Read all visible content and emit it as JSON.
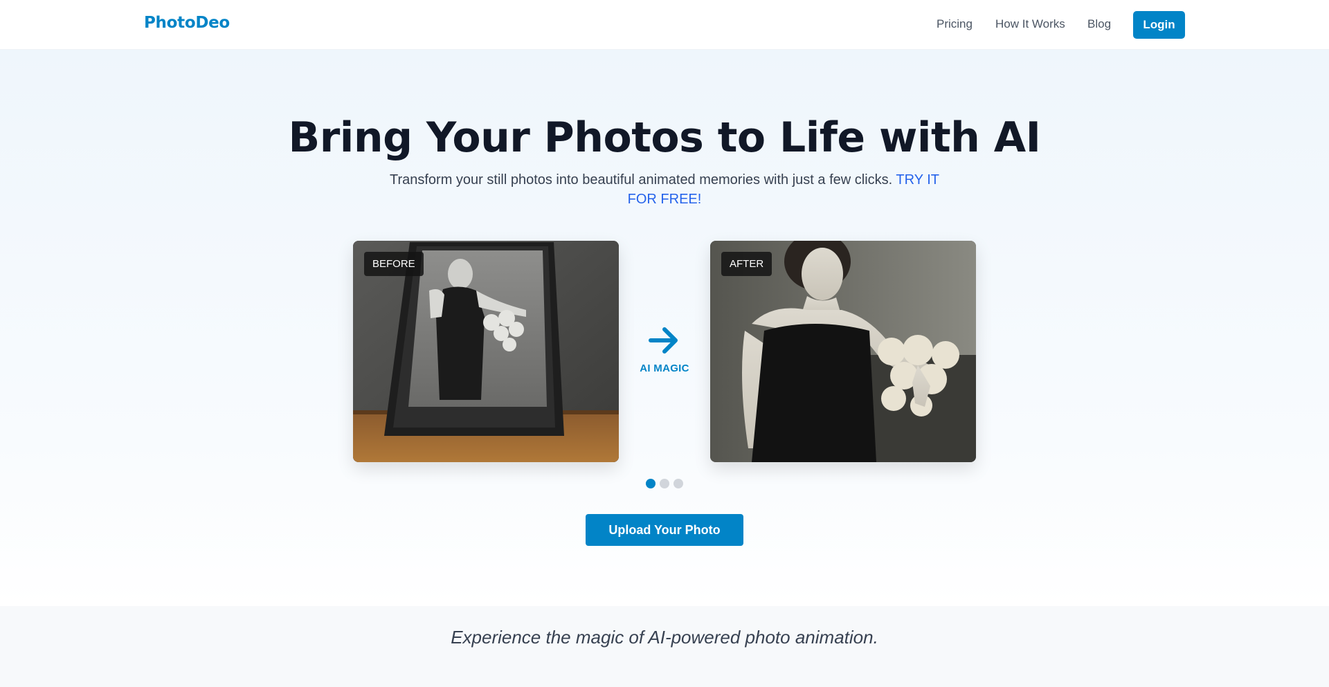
{
  "header": {
    "logo": "PhotoDeo",
    "nav": {
      "pricing": "Pricing",
      "how_it_works": "How It Works",
      "blog": "Blog"
    },
    "login_label": "Login"
  },
  "hero": {
    "title": "Bring Your Photos to Life with AI",
    "subtitle": "Transform your still photos into beautiful animated memories with just a few clicks.",
    "cta_text": "TRY IT FOR FREE!",
    "before_label": "BEFORE",
    "after_label": "AFTER",
    "magic_label": "AI MAGIC",
    "carousel": {
      "active_index": 0,
      "total": 3
    },
    "upload_label": "Upload Your Photo"
  },
  "band": {
    "tagline": "Experience the magic of AI-powered photo animation."
  },
  "colors": {
    "brand": "#0284c7",
    "cta_text": "#2563eb",
    "heading": "#111827"
  },
  "icons": {
    "arrow": "arrow-right-icon"
  }
}
